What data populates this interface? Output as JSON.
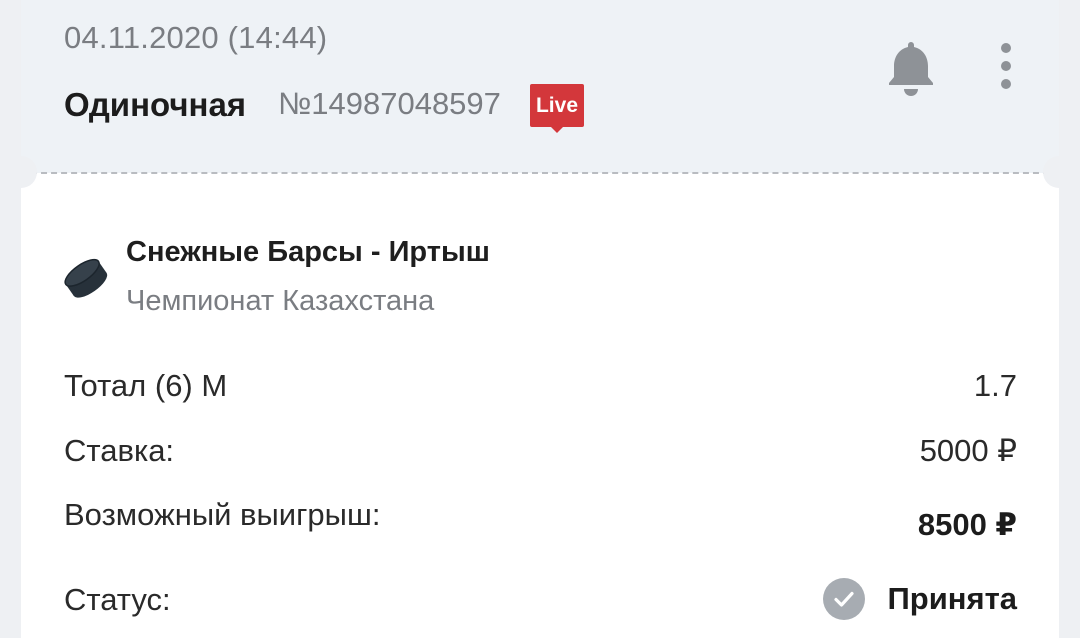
{
  "header": {
    "datetime": "04.11.2020 (14:44)",
    "bet_type": "Одиночная",
    "bet_number": "№14987048597",
    "live_badge": "Live"
  },
  "event": {
    "sport_icon": "hockey-puck-icon",
    "title": "Снежные Барсы - Иртыш",
    "league": "Чемпионат Казахстана"
  },
  "details": {
    "market_label": "Тотал (6) М",
    "odds": "1.7",
    "stake_label": "Ставка:",
    "stake_value": "5000 ₽",
    "payout_label": "Возможный выигрыш:",
    "payout_value": "8500 ₽",
    "status_label": "Статус:",
    "status_value": "Принята"
  },
  "colors": {
    "live_badge": "#d3373b",
    "header_bg": "#eef2f6",
    "status_check": "#a7acb2"
  }
}
